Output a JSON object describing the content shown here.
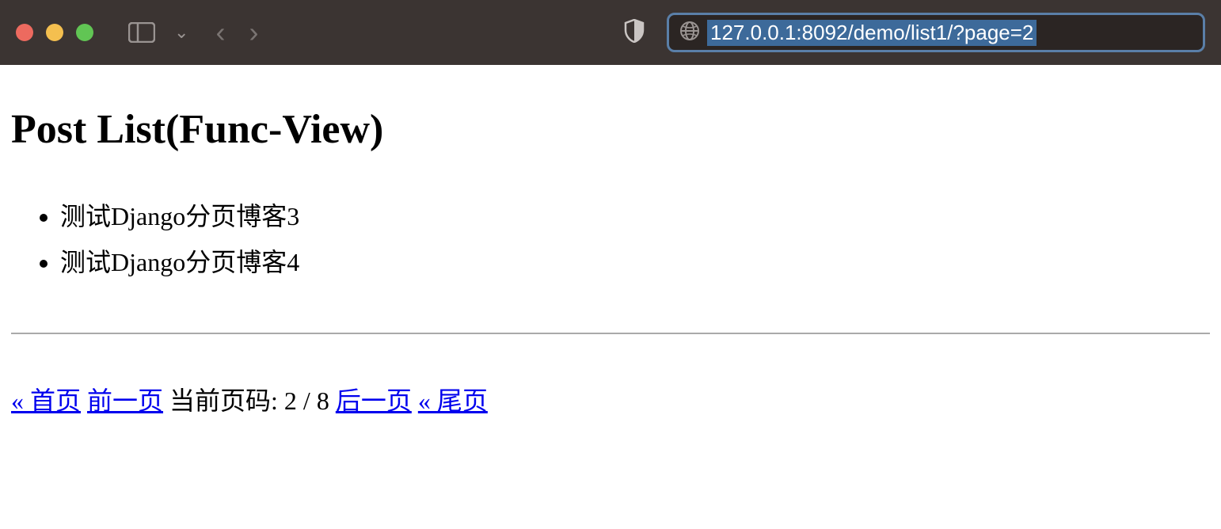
{
  "browser": {
    "url": "127.0.0.1:8092/demo/list1/?page=2"
  },
  "page": {
    "title": "Post List(Func-View)",
    "posts": [
      "测试Django分页博客3",
      "测试Django分页博客4"
    ],
    "pagination": {
      "first": "« 首页",
      "prev": "前一页",
      "current_label": "当前页码: 2 / 8",
      "next": "后一页",
      "last": "« 尾页"
    }
  }
}
